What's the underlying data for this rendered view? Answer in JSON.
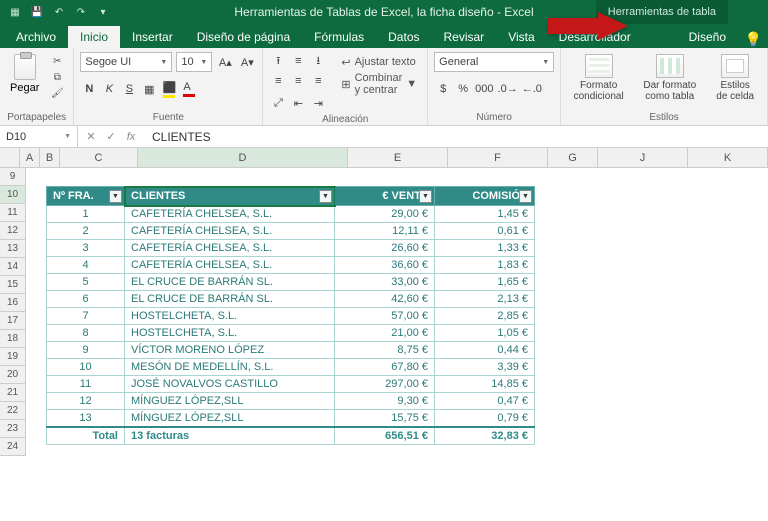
{
  "title": "Herramientas de Tablas de Excel, la ficha diseño - Excel",
  "tableTools": "Herramientas de tabla",
  "tabs": {
    "archivo": "Archivo",
    "inicio": "Inicio",
    "insertar": "Insertar",
    "diseno_pagina": "Diseño de página",
    "formulas": "Fórmulas",
    "datos": "Datos",
    "revisar": "Revisar",
    "vista": "Vista",
    "desarrollador": "Desarrollador",
    "diseno": "Diseño"
  },
  "groups": {
    "portapapeles": "Portapapeles",
    "fuente": "Fuente",
    "alineacion": "Alineación",
    "numero": "Número",
    "estilos": "Estilos"
  },
  "ribbon": {
    "paste": "Pegar",
    "fontName": "Segoe UI",
    "fontSize": "10",
    "wrap": "Ajustar texto",
    "merge": "Combinar y centrar",
    "numFmt": "General",
    "condFmt": "Formato condicional",
    "fmtTable": "Dar formato como tabla",
    "cellStyles": "Estilos de celda"
  },
  "nameBox": "D10",
  "formula": "CLIENTES",
  "cols": [
    "A",
    "B",
    "C",
    "D",
    "E",
    "F",
    "G",
    "J",
    "K"
  ],
  "rowNums": [
    "9",
    "10",
    "11",
    "12",
    "13",
    "14",
    "15",
    "16",
    "17",
    "18",
    "19",
    "20",
    "21",
    "22",
    "23",
    "24"
  ],
  "headers": {
    "c": "Nº FRA.",
    "d": "CLIENTES",
    "e": "€ VENTA",
    "f": "COMISIÓN"
  },
  "rows": [
    {
      "n": "1",
      "cli": "CAFETERÍA CHELSEA, S.L.",
      "v": "29,00 €",
      "c": "1,45 €"
    },
    {
      "n": "2",
      "cli": "CAFETERÍA CHELSEA, S.L.",
      "v": "12,11 €",
      "c": "0,61 €"
    },
    {
      "n": "3",
      "cli": "CAFETERÍA CHELSEA, S.L.",
      "v": "26,60 €",
      "c": "1,33 €"
    },
    {
      "n": "4",
      "cli": "CAFETERÍA CHELSEA, S.L.",
      "v": "36,60 €",
      "c": "1,83 €"
    },
    {
      "n": "5",
      "cli": "EL CRUCE DE BARRÁN SL.",
      "v": "33,00 €",
      "c": "1,65 €"
    },
    {
      "n": "6",
      "cli": "EL CRUCE DE BARRÁN SL.",
      "v": "42,60 €",
      "c": "2,13 €"
    },
    {
      "n": "7",
      "cli": "HOSTELCHETA, S.L.",
      "v": "57,00 €",
      "c": "2,85 €"
    },
    {
      "n": "8",
      "cli": "HOSTELCHETA, S.L.",
      "v": "21,00 €",
      "c": "1,05 €"
    },
    {
      "n": "9",
      "cli": "VÍCTOR MORENO LÓPEZ",
      "v": "8,75 €",
      "c": "0,44 €"
    },
    {
      "n": "10",
      "cli": "MESÓN DE MEDELLÍN, S.L.",
      "v": "67,80 €",
      "c": "3,39 €"
    },
    {
      "n": "11",
      "cli": "JOSÉ NOVALVOS CASTILLO",
      "v": "297,00 €",
      "c": "14,85 €"
    },
    {
      "n": "12",
      "cli": "MÍNGUEZ LÓPEZ,SLL",
      "v": "9,30 €",
      "c": "0,47 €"
    },
    {
      "n": "13",
      "cli": "MÍNGUEZ LÓPEZ,SLL",
      "v": "15,75 €",
      "c": "0,79 €"
    }
  ],
  "totals": {
    "label": "Total",
    "count": "13 facturas",
    "venta": "656,51 €",
    "com": "32,83 €"
  }
}
